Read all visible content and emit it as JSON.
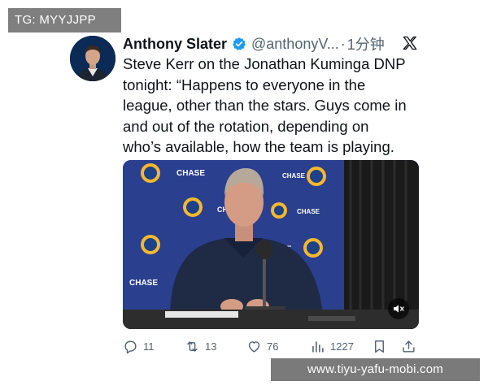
{
  "overlays": {
    "tg_label": "TG: MYYJJPP",
    "site_watermark": "www.tiyu-yafu-mobi.com"
  },
  "tweet": {
    "author_name": "Anthony Slater",
    "handle": "@anthonyV...",
    "separator": "·",
    "time": "1分钟",
    "text": "Steve Kerr on the Jonathan Kuminga DNP\ntonight: “Happens to everyone in the\nleague, other than the stars. Guys come in\nand out of the rotation, depending on\nwho’s available, how the team is playing.",
    "media": {
      "backdrop_sponsor_1": "CHASE",
      "backdrop_sponsor_2": "CHASE",
      "backdrop_sponsor_3": "CHASE",
      "backdrop_sponsor_4": "CHASE",
      "backdrop_sponsor_5": "CHASE",
      "backdrop_sponsor_6": "CHASE",
      "mute_icon": "speaker-muted-icon"
    },
    "actions": {
      "replies": "11",
      "reposts": "13",
      "likes": "76",
      "views": "1227"
    }
  },
  "colors": {
    "text_primary": "#0f1419",
    "text_secondary": "#536471",
    "verified_blue": "#1d9bf0",
    "backdrop_blue": "#2b3f8f",
    "warriors_gold": "#f5b82e",
    "overlay_gray": "#7f7f7f"
  }
}
